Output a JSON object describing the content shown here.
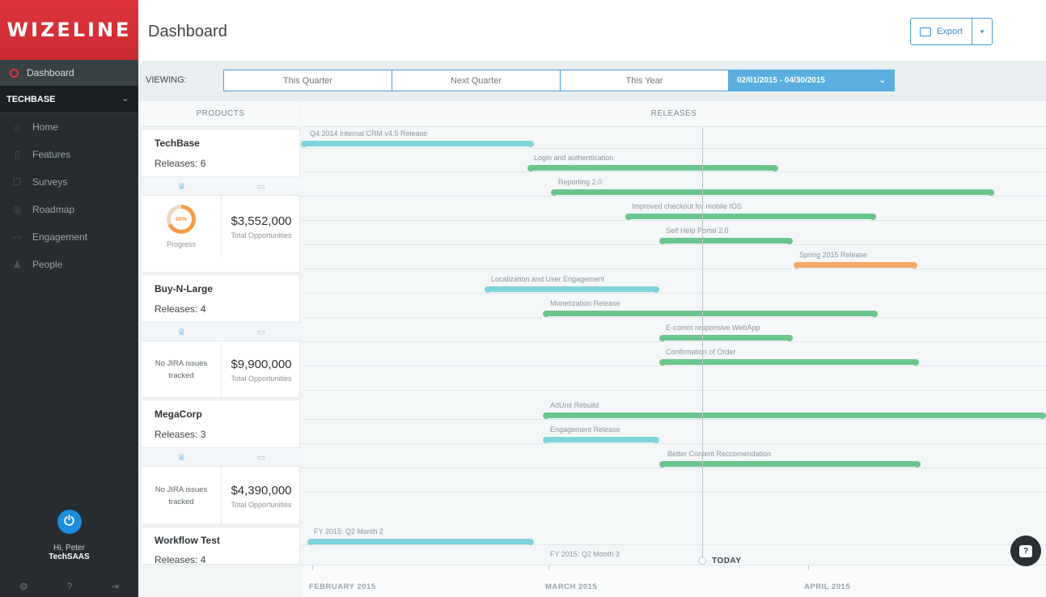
{
  "sidebar": {
    "logo": "WIZELINE",
    "active": "Dashboard",
    "org": "TECHBASE",
    "items": [
      {
        "label": "Home",
        "icon": "home-icon"
      },
      {
        "label": "Features",
        "icon": "document-icon"
      },
      {
        "label": "Surveys",
        "icon": "checkbox-icon"
      },
      {
        "label": "Roadmap",
        "icon": "roadmap-icon"
      },
      {
        "label": "Engagement",
        "icon": "chart-icon"
      },
      {
        "label": "People",
        "icon": "people-icon"
      }
    ],
    "user_greeting": "Hi, Peter",
    "user_company": "TechSAAS"
  },
  "header": {
    "title": "Dashboard",
    "export_label": "Export"
  },
  "viewing": {
    "label": "VIEWING:",
    "options": [
      "This Quarter",
      "Next Quarter",
      "This Year"
    ],
    "date_range": "02/01/2015 - 04/30/2015"
  },
  "columns": {
    "products": "PRODUCTS",
    "releases": "RELEASES"
  },
  "products": [
    {
      "name": "TechBase",
      "releases": "Releases: 6",
      "progress_value": "68%",
      "progress_label": "Progress",
      "amount": "$3,552,000",
      "amount_label": "Total Opportunities"
    },
    {
      "name": "Buy-N-Large",
      "releases": "Releases: 4",
      "jira": "No JIRA issues tracked",
      "amount": "$9,900,000",
      "amount_label": "Total Opportunities"
    },
    {
      "name": "MegaCorp",
      "releases": "Releases: 3",
      "jira": "No JIRA issues tracked",
      "amount": "$4,390,000",
      "amount_label": "Total Opportunities"
    },
    {
      "name": "Workflow Test",
      "releases": "Releases: 4"
    }
  ],
  "releases": [
    {
      "label": "Q4 2014 Internal CRM v4.5 Release",
      "color": "#7fd3dc"
    },
    {
      "label": "Login and authentication",
      "color": "#6cc58a"
    },
    {
      "label": "Reporting 2.0",
      "color": "#6cc58a"
    },
    {
      "label": "Improved checkout for mobile IOS",
      "color": "#6cc58a"
    },
    {
      "label": "Self Help Portal 2.0",
      "color": "#6cc58a"
    },
    {
      "label": "Spring 2015 Release",
      "color": "#f3a866"
    },
    {
      "label": "Localization and User Engagement",
      "color": "#7fd3dc"
    },
    {
      "label": "Monetization Release",
      "color": "#6cc58a"
    },
    {
      "label": "E-comm responsive WebApp",
      "color": "#6cc58a"
    },
    {
      "label": "Confirmation of Order",
      "color": "#6cc58a"
    },
    {
      "label": "AdUnit Rebuild",
      "color": "#6cc58a"
    },
    {
      "label": "Engagement Release",
      "color": "#7fd3dc"
    },
    {
      "label": "Better Content Reccomendation",
      "color": "#6cc58a"
    },
    {
      "label": "FY 2015: Q2 Month 2",
      "color": "#7fd3dc"
    },
    {
      "label": "FY 2015: Q2 Month 3",
      "color": "#7fd3dc"
    }
  ],
  "timeline": {
    "today": "TODAY",
    "months": [
      "FEBRUARY 2015",
      "MARCH 2015",
      "APRIL 2015"
    ]
  }
}
